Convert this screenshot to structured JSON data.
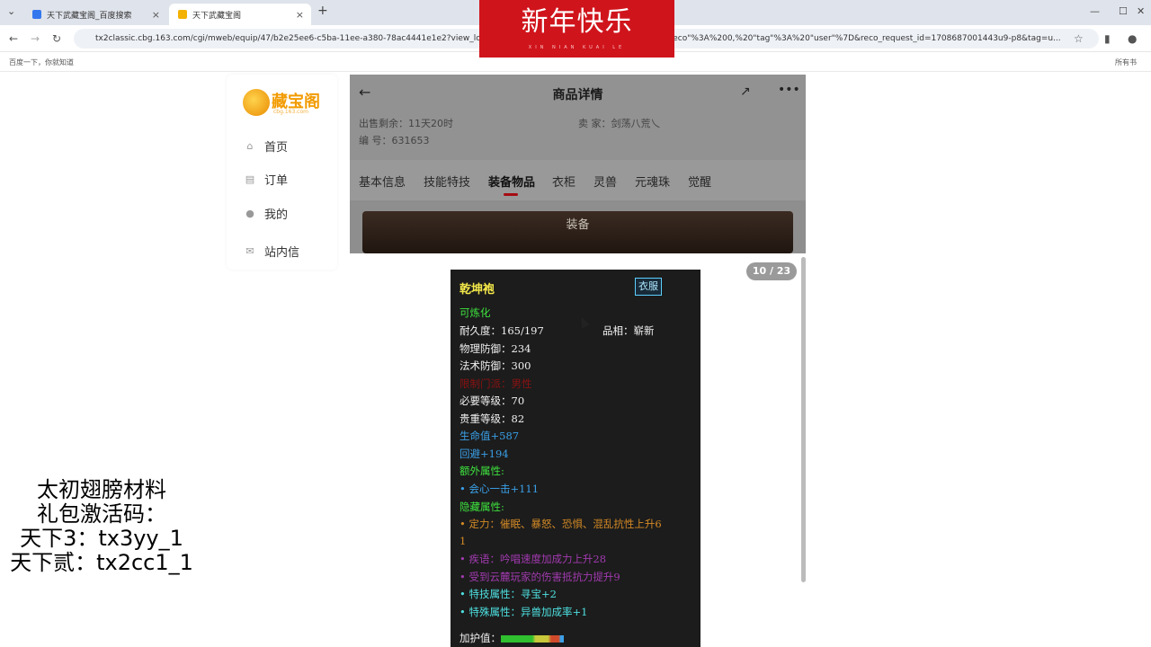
{
  "browser": {
    "tabs": [
      {
        "title": "天下武藏宝阁_百度搜索",
        "active": false
      },
      {
        "title": "天下武藏宝阁",
        "active": true
      }
    ],
    "new_tab": "+",
    "url": "tx2classic.cbg.163.com/cgi/mweb/equip/47/b2e25ee6-c5ba-11ee-a380-78ac4441e1e2?view_lo",
    "url_tail": "reco\"%3A%200,%20\"tag\"%3A%20\"user\"%7D&reco_request_id=1708687001443u9-p8&tag=u...",
    "bookmark": "百度一下，你就知道",
    "all_bookmarks": "所有书"
  },
  "banner": {
    "text": "新年快乐",
    "sub": "XIN NIAN KUAI LE"
  },
  "sidebar": {
    "logo_text": "藏宝阁",
    "logo_sub": "cbg.163.com",
    "items": [
      {
        "label": "首页",
        "icon": "home-icon"
      },
      {
        "label": "订单",
        "icon": "order-icon"
      },
      {
        "label": "我的",
        "icon": "user-icon"
      },
      {
        "label": "站内信",
        "icon": "mail-icon"
      }
    ]
  },
  "detail": {
    "title": "商品详情",
    "sale_left": "出售剩余：11天20时",
    "seller": "卖 家：剑荡八荒乀",
    "serial": "编 号：631653",
    "tabs": [
      "基本信息",
      "技能特技",
      "装备物品",
      "衣柜",
      "灵兽",
      "元魂珠",
      "觉醒"
    ],
    "active_tab": "装备物品",
    "equip_label": "装备"
  },
  "viewer": {
    "counter": "10 / 23"
  },
  "item": {
    "name": "乾坤袍",
    "type_badge": "衣服",
    "refinable": "可炼化",
    "durability": "耐久度：165/197",
    "quality": "品相：崭新",
    "phys_def": "物理防御：234",
    "magic_def": "法术防御：300",
    "gender_req": "限制门派：男性",
    "level_req": "必要等级：70",
    "value_level": "贵重等级：82",
    "hp": "生命值+587",
    "dodge": "回避+194",
    "extra_title": "额外属性:",
    "extra_1": "• 会心一击+111",
    "hidden_title": "隐藏属性:",
    "hidden_1a": "• 定力：催眠、暴怒、恐惧、混乱抗性上升6",
    "hidden_1b": "1",
    "hidden_2": "• 疾语：吟唱速度加成力上升28",
    "hidden_3": "• 受到云麓玩家的伤害抵抗力提升9",
    "skill_1": "• 特技属性：寻宝+2",
    "special_1": "• 特殊属性：异兽加成率+1",
    "guard": "加护值："
  },
  "promo": {
    "line1": "太初翅膀材料",
    "line2": "礼包激活码：",
    "line3": "天下3：tx3yy_1",
    "line4": "天下贰：tx2cc1_1"
  }
}
